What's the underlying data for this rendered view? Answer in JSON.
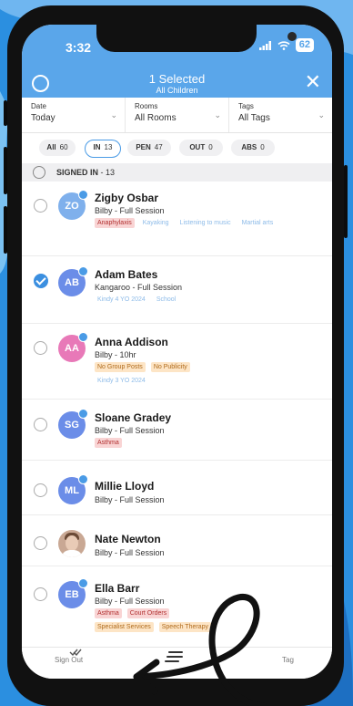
{
  "status_bar": {
    "time": "3:32",
    "battery": "62"
  },
  "header": {
    "title": "1 Selected",
    "subtitle": "All Children"
  },
  "filters": [
    {
      "label": "Date",
      "value": "Today"
    },
    {
      "label": "Rooms",
      "value": "All Rooms"
    },
    {
      "label": "Tags",
      "value": "All Tags"
    }
  ],
  "pills": [
    {
      "label": "All",
      "count": "60"
    },
    {
      "label": "IN",
      "count": "13"
    },
    {
      "label": "PEN",
      "count": "47"
    },
    {
      "label": "OUT",
      "count": "0"
    },
    {
      "label": "ABS",
      "count": "0"
    }
  ],
  "section": {
    "title": "SIGNED IN",
    "count": "- 13"
  },
  "children": [
    {
      "initials": "ZO",
      "name": "Zigby Osbar",
      "room": "Bilby - Full Session",
      "tags": [
        "Anaphylaxis",
        "Kayaking",
        "Listening to music",
        "Martial arts"
      ]
    },
    {
      "initials": "AB",
      "name": "Adam Bates",
      "room": "Kangaroo - Full Session",
      "tags": [
        "Kindy 4 YO 2024",
        "School"
      ]
    },
    {
      "initials": "AA",
      "name": "Anna Addison",
      "room": "Bilby - 10hr",
      "tags": [
        "No Group Posts",
        "No Publicity",
        "Kindy 3 YO 2024"
      ]
    },
    {
      "initials": "SG",
      "name": "Sloane Gradey",
      "room": "Bilby - Full Session",
      "tags": [
        "Asthma"
      ]
    },
    {
      "initials": "ML",
      "name": "Millie Lloyd",
      "room": "Bilby - Full Session",
      "tags": []
    },
    {
      "initials": "",
      "name": "Nate Newton",
      "room": "Bilby - Full Session",
      "tags": []
    },
    {
      "initials": "EB",
      "name": "Ella Barr",
      "room": "Bilby - Full Session",
      "tags": [
        "Asthma",
        "Court Orders",
        "Specialist Services",
        "Speech Therapy"
      ]
    }
  ],
  "bottom_nav": {
    "left_label": "Sign Out",
    "right_label": "Tag"
  },
  "colors": {
    "header": "#5aa6ea",
    "accent": "#3b8fe0",
    "tag_red": "#f9d4d4",
    "tag_orange": "#fde5c6",
    "avatar_blue": "#6b8de8",
    "avatar_pink": "#e879b8"
  },
  "icons": [
    "select-all-icon",
    "close-icon",
    "chevron-down-icon",
    "checkmark-icon",
    "menu-icon",
    "wifi-icon",
    "signal-icon"
  ]
}
